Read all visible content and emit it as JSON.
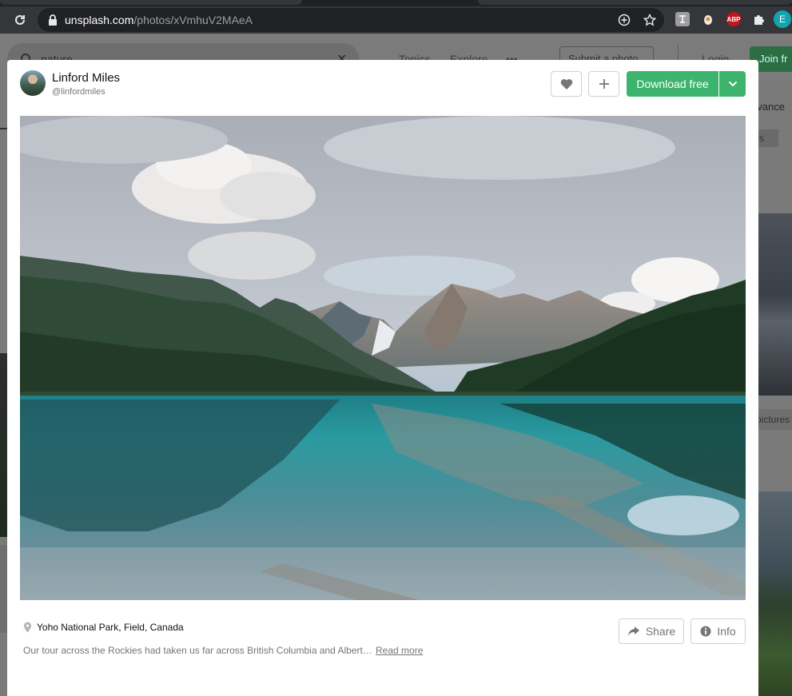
{
  "browser": {
    "url_host": "unsplash.com",
    "url_path": "/photos/xVmhuV2MAeA",
    "extensions": [
      {
        "icon": "translate-extension-icon",
        "color": "#9e9e9e"
      },
      {
        "icon": "fox-extension-icon",
        "color": "#e9e9e9"
      },
      {
        "icon": "adblock-plus-icon",
        "color": "#c4151c",
        "label": "ABP"
      },
      {
        "icon": "puzzle-extensions-icon",
        "color": "#ffffff"
      }
    ],
    "profile_initial": "E",
    "profile_color": "#12a5b0"
  },
  "background_page": {
    "search_query": "nature",
    "nav": [
      "Topics",
      "Explore",
      "•••"
    ],
    "submit_label": "Submit a photo",
    "login_label": "Login",
    "join_label": "Join fr",
    "relevance_label": "evance",
    "tag_label": "rs",
    "pictures_label": "pictures"
  },
  "modal": {
    "author": {
      "name": "Linford Miles",
      "handle": "@linfordmiles"
    },
    "actions": {
      "like_icon": "heart-icon",
      "add_icon": "plus-icon",
      "download_label": "Download free",
      "download_menu_icon": "chevron-down-icon"
    },
    "photo": {
      "subject": "mountain-lake-reflection"
    },
    "location": "Yoho National Park, Field, Canada",
    "description": "Our tour across the Rockies had taken us far across British Columbia and Albert…",
    "read_more_label": "Read more",
    "share_label": "Share",
    "info_label": "Info",
    "colors": {
      "accent_green": "#3cb46e",
      "text_primary": "#111111",
      "text_secondary": "#767676",
      "border": "#d1d1d1"
    }
  }
}
